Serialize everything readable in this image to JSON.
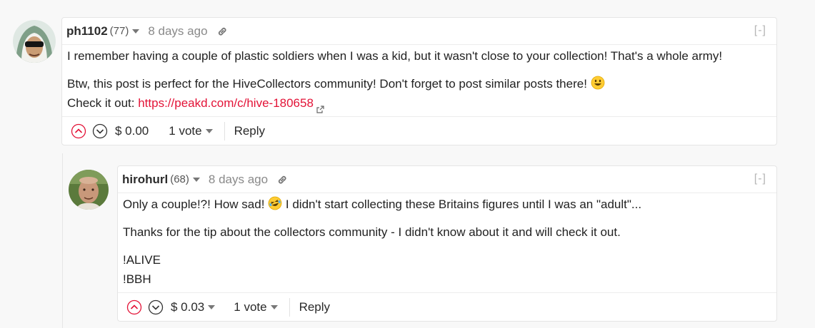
{
  "comments": [
    {
      "author": "ph1102",
      "reputation": "(77)",
      "time": "8 days ago",
      "collapse": "[-]",
      "paragraphs": {
        "p1": "I remember having a couple of plastic soldiers when I was a kid, but it wasn't close to your collection! That's a whole army!",
        "p2": "Btw, this post is perfect for the HiveCollectors community! Don't forget to post similar posts there!",
        "p3_prefix": "Check it out: ",
        "p3_link": "https://peakd.com/c/hive-180658"
      },
      "payout": "$ 0.00",
      "votes": "1 vote",
      "reply": "Reply"
    },
    {
      "author": "hirohurl",
      "reputation": "(68)",
      "time": "8 days ago",
      "collapse": "[-]",
      "paragraphs": {
        "p1_a": "Only a couple!?! How sad!",
        "p1_b": " I didn't start collecting these Britains figures until I was an \"adult\"...",
        "p2": "Thanks for the tip about the collectors community - I didn't know about it and will check it out.",
        "p3_l1": "!ALIVE",
        "p3_l2": "!BBH"
      },
      "payout": "$ 0.03",
      "votes": "1 vote",
      "reply": "Reply"
    }
  ],
  "colors": {
    "accent": "#e31337",
    "muted": "#8a8a8a",
    "border": "#e5e5e5"
  },
  "icons": [
    "avatar",
    "link-icon",
    "external-link-icon",
    "upvote-icon",
    "downvote-icon",
    "caret-down-icon",
    "smiley-emoji-icon",
    "laughing-emoji-icon"
  ]
}
